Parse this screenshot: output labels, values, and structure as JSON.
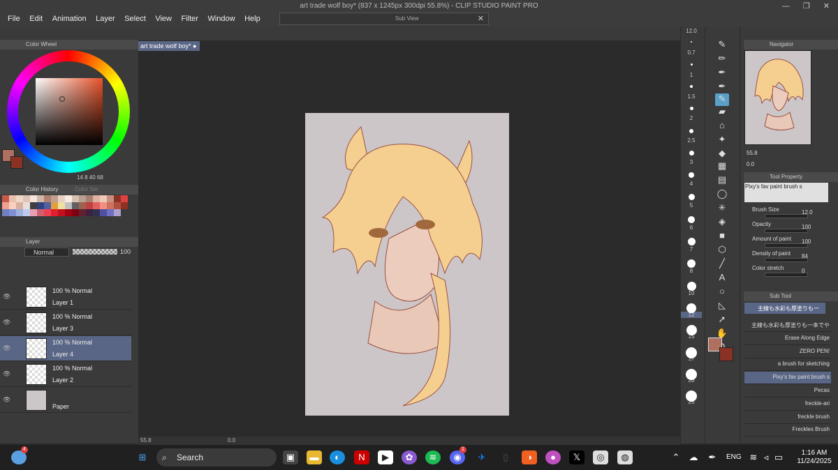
{
  "window": {
    "title": "art trade wolf boy* (837 x 1245px 300dpi 55.8%) - CLIP STUDIO PAINT PRO",
    "controls": "— ❐ ✕"
  },
  "menu": [
    "File",
    "Edit",
    "Animation",
    "Layer",
    "Select",
    "View",
    "Filter",
    "Window",
    "Help"
  ],
  "subview": {
    "label": "Sub View",
    "close": "✕"
  },
  "color_wheel": {
    "title": "Color Wheel",
    "readout": "14  8  40  68",
    "main_color": "#b07060",
    "sub_color": "#8a3324",
    "accent": "#e8532a"
  },
  "color_history": {
    "tab1": "Color History",
    "tab2": "Color Set",
    "swatches": [
      "#c85a4a",
      "#e8c0b0",
      "#f0d8c8",
      "#e0c4b8",
      "#f4e4dc",
      "#d0b8a8",
      "#b08070",
      "#c0a090",
      "#e8d0c0",
      "#f8ece4",
      "#d8c0b0",
      "#b8a090",
      "#a88070",
      "#e0b0a0",
      "#f0c8b8",
      "#c89080",
      "#8a3324",
      "#e04040",
      "#f0a090",
      "#f8d0c0",
      "#d8b0a0",
      "#e8e0d8",
      "#404040",
      "#304080",
      "#5060a0",
      "#e0a040",
      "#f0e0a0",
      "#c0c0c0",
      "#606060",
      "#a06050",
      "#c04040",
      "#e06060",
      "#f09080",
      "#d07060",
      "#b05040",
      "#903020",
      "#7080c0",
      "#8090d0",
      "#a0b0e0",
      "#c0c8f0",
      "#e8a0b0",
      "#d06070",
      "#f04050",
      "#e02030",
      "#c01020",
      "#a00010",
      "#800010",
      "#602030",
      "#402040",
      "#303050",
      "#5050a0",
      "#7070c0",
      "#b0a0d0"
    ]
  },
  "layer_panel": {
    "title": "Layer",
    "blend_mode": "Normal",
    "opacity": "100",
    "layers": [
      {
        "mode": "100 % Normal",
        "name": "Layer 1"
      },
      {
        "mode": "100 % Normal",
        "name": "Layer 3"
      },
      {
        "mode": "100 % Normal",
        "name": "Layer 4",
        "selected": true
      },
      {
        "mode": "100 % Normal",
        "name": "Layer 2"
      },
      {
        "mode": "",
        "name": "Paper"
      }
    ]
  },
  "document_tab": "art trade wolf boy*",
  "status": {
    "zoom": "55.8",
    "angle": "0.0"
  },
  "brush_sizes": [
    "12.0",
    "0.7",
    "1",
    "1.5",
    "2",
    "2.5",
    "3",
    "4",
    "5",
    "6",
    "7",
    "8",
    "10",
    "12",
    "15",
    "17",
    "20",
    "25"
  ],
  "navigator": {
    "title": "Navigator",
    "zoom": "55.8",
    "angle": "0.0"
  },
  "tool_property": {
    "title": "Tool Property",
    "preset": "Pixy's fav paint brush s",
    "props": [
      {
        "label": "Brush Size",
        "value": "12.0"
      },
      {
        "label": "Opacity",
        "value": "100"
      },
      {
        "label": "Amount of paint",
        "value": "100"
      },
      {
        "label": "Density of paint",
        "value": "84"
      },
      {
        "label": "Color stretch",
        "value": "0"
      }
    ]
  },
  "sub_tool": {
    "title": "Sub Tool",
    "group": "主線も水彩も厚塗りも一",
    "items": [
      "主線も水彩も厚塗りも一本でや",
      "Erase Along Edge",
      "ZERO PEN!",
      "a brush  for sketching",
      "Pixy's fav paint brush s",
      "Pecas",
      "freckle-ari",
      "freckle brush",
      "Freckles Brush"
    ]
  },
  "taskbar": {
    "search": "Search",
    "language": "ENG",
    "time": "1:16 AM",
    "date": "11/24/2025",
    "badge1": "4",
    "badge2": "1"
  }
}
